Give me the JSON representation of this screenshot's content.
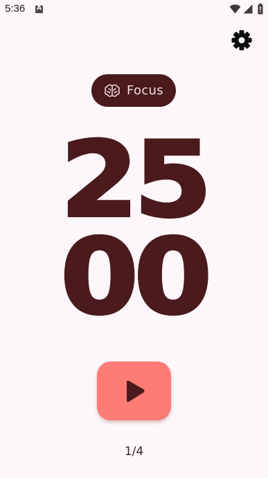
{
  "status_bar": {
    "time": "5:36",
    "notification_icon": "a-icon",
    "icons": [
      "wifi-icon",
      "signal-icon",
      "battery-icon"
    ]
  },
  "header": {
    "settings_icon": "gear-icon"
  },
  "mode": {
    "icon": "brain-icon",
    "label": "Focus"
  },
  "timer": {
    "minutes": "25",
    "seconds": "00"
  },
  "controls": {
    "play_icon": "play-icon"
  },
  "session": {
    "counter": "1/4"
  },
  "colors": {
    "background": "#fdf6fb",
    "primary": "#4a1a1c",
    "chip_text": "#f4dcdc",
    "play_button": "#ff7b76"
  }
}
